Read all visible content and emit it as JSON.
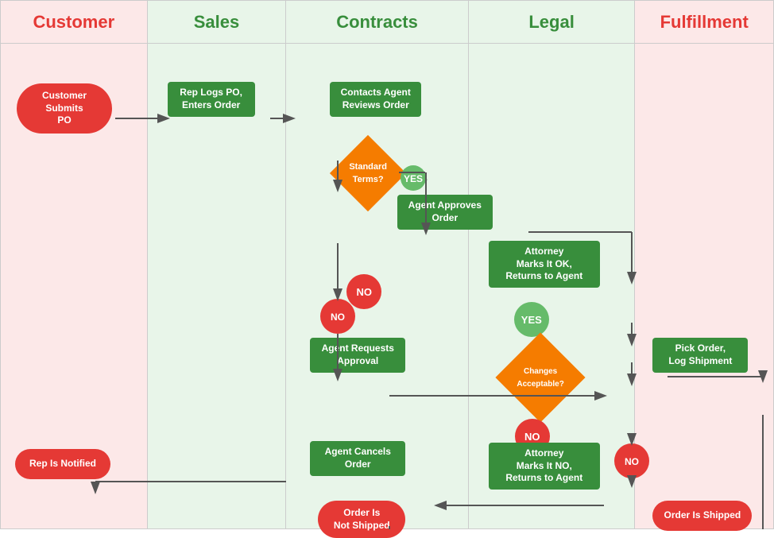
{
  "lanes": [
    {
      "id": "customer",
      "label": "Customer",
      "color": "#e53935"
    },
    {
      "id": "sales",
      "label": "Sales",
      "color": "#388e3c"
    },
    {
      "id": "contracts",
      "label": "Contracts",
      "color": "#388e3c"
    },
    {
      "id": "legal",
      "label": "Legal",
      "color": "#388e3c"
    },
    {
      "id": "fulfillment",
      "label": "Fulfillment",
      "color": "#e53935"
    }
  ],
  "nodes": {
    "customer_submits_po": "Customer Submits\nPO",
    "rep_logs_po": "Rep Logs PO,\nEnters Order",
    "contacts_agent": "Contacts Agent\nReviews Order",
    "standard_terms": "Standard\nTerms?",
    "yes1": "YES",
    "agent_approves": "Agent Approves\nOrder",
    "no1": "NO",
    "agent_requests": "Agent Requests\nApproval",
    "attorney_marks_ok": "Attorney\nMarks It OK,\nReturns to Agent",
    "yes2": "YES",
    "changes_acceptable": "Changes\nAcceptable?",
    "no2": "NO",
    "pick_order": "Pick Order,\nLog Shipment",
    "agent_cancels": "Agent Cancels\nOrder",
    "attorney_marks_no": "Attorney\nMarks It NO,\nReturns to Agent",
    "rep_notified": "Rep Is Notified",
    "order_not_shipped": "Order Is\nNot Shipped",
    "order_shipped": "Order Is Shipped"
  }
}
